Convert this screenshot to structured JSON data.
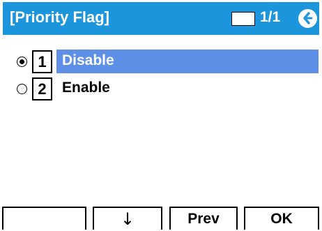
{
  "header": {
    "title": "[Priority Flag]",
    "page_indicator": "1/1",
    "colors": {
      "title_bar": "#1c95dd",
      "highlight": "#5d8fe6"
    }
  },
  "menu": {
    "items": [
      {
        "number": "1",
        "label": "Disable",
        "selected": true,
        "highlighted": true
      },
      {
        "number": "2",
        "label": "Enable",
        "selected": false,
        "highlighted": false
      }
    ]
  },
  "softkeys": {
    "key1": "",
    "key2": "↓",
    "key3": "Prev",
    "key4": "OK"
  },
  "icons": {
    "back": "back-arrow-icon",
    "radio_selected": "radio-checked-icon",
    "radio_unselected": "radio-unchecked-icon"
  }
}
